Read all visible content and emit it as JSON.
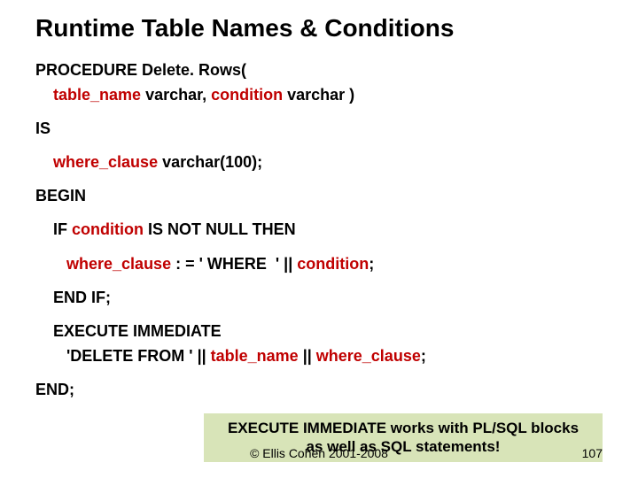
{
  "title": "Runtime Table Names & Conditions",
  "code": {
    "l1a": "PROCEDURE Delete. Rows(",
    "l2a": "    table_name",
    "l2b": " varchar, ",
    "l2c": "condition",
    "l2d": " varchar )",
    "l3": "IS",
    "l4a": "    where_clause",
    "l4b": " varchar(100);",
    "l5": "BEGIN",
    "l6a": "    IF ",
    "l6b": "condition",
    "l6c": " IS NOT NULL THEN",
    "l7a": "       where_clause",
    "l7b": " : = ' WHERE  ' || ",
    "l7c": "condition",
    "l7d": ";",
    "l8": "    END IF;",
    "l9": "    EXECUTE IMMEDIATE",
    "l10a": "       'DELETE FROM ' || ",
    "l10b": "table_name",
    "l10c": " || ",
    "l10d": "where_clause",
    "l10e": ";",
    "l11": "END;"
  },
  "callout": "EXECUTE IMMEDIATE works with PL/SQL blocks as well as SQL statements!",
  "copyright": "© Ellis Cohen 2001-2008",
  "page": "107"
}
